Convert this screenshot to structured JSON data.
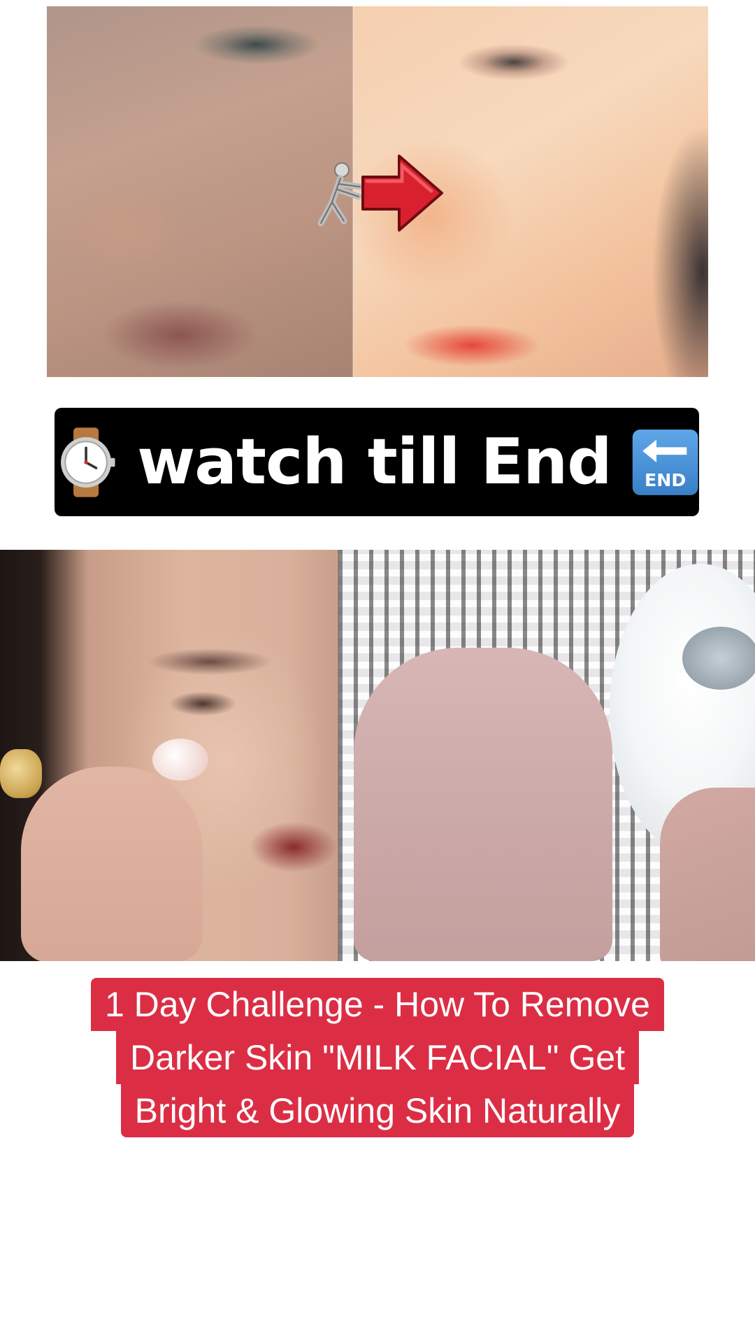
{
  "before_after": {
    "before_description": "",
    "after_description": "",
    "arrow_icon": "person-pushing-arrow-icon"
  },
  "banner": {
    "watch_icon": "wristwatch-icon",
    "text": "watch till End",
    "end_icon": "end-arrow-icon"
  },
  "split_image": {
    "left_icon": "face-cream-application",
    "right_icon": "hand-and-milk-bowl"
  },
  "caption": {
    "line1": "1 Day Challenge - How To Remove",
    "line2": "Darker Skin \"MILK FACIAL\"  Get",
    "line3": "Bright & Glowing Skin Naturally"
  },
  "colors": {
    "caption_bg": "#db2e45",
    "banner_bg": "#000000",
    "text": "#ffffff"
  }
}
